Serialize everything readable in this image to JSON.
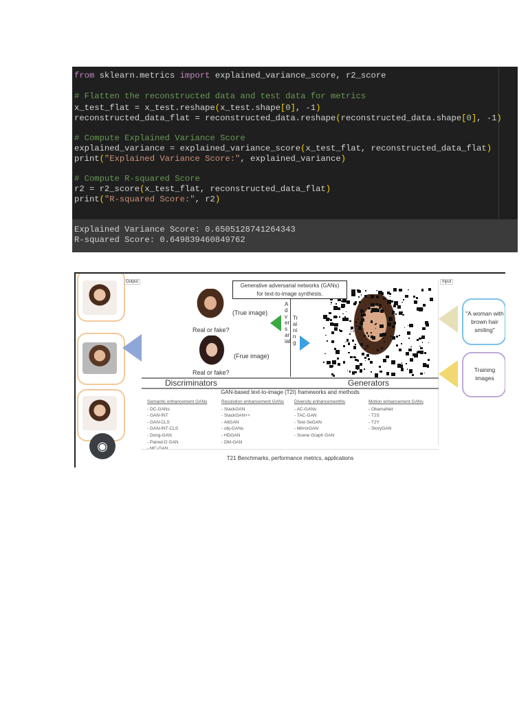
{
  "code": {
    "lines": [
      [
        [
          "from",
          "kw"
        ],
        [
          " sklearn.metrics ",
          ""
        ],
        [
          "import",
          "kw"
        ],
        [
          " explained_variance_score, r2_score",
          ""
        ]
      ],
      [],
      [
        [
          "# Flatten the reconstructed data and test data for metrics",
          "cm"
        ]
      ],
      [
        [
          "x_test_flat = x_test.reshape",
          ""
        ],
        [
          "(",
          "pn"
        ],
        [
          "x_test.shape",
          ""
        ],
        [
          "[",
          "pn"
        ],
        [
          "0",
          "nm"
        ],
        [
          "]",
          "pn"
        ],
        [
          ", -1",
          ""
        ],
        [
          ")",
          "pn"
        ]
      ],
      [
        [
          "reconstructed_data_flat = reconstructed_data.reshape",
          ""
        ],
        [
          "(",
          "pn"
        ],
        [
          "reconstructed_data.shape",
          ""
        ],
        [
          "[",
          "pn"
        ],
        [
          "0",
          "nm"
        ],
        [
          "]",
          "pn"
        ],
        [
          ", -1",
          ""
        ],
        [
          ")",
          "pn"
        ]
      ],
      [],
      [
        [
          "# Compute Explained Variance Score",
          "cm"
        ]
      ],
      [
        [
          "explained_variance = explained_variance_score",
          ""
        ],
        [
          "(",
          "pn"
        ],
        [
          "x_test_flat, reconstructed_data_flat",
          ""
        ],
        [
          ")",
          "pn"
        ]
      ],
      [
        [
          "print",
          ""
        ],
        [
          "(",
          "pn"
        ],
        [
          "\"Explained Variance Score:\"",
          "st"
        ],
        [
          ", explained_variance",
          ""
        ],
        [
          ")",
          "pn"
        ]
      ],
      [],
      [
        [
          "# Compute R-squared Score",
          "cm"
        ]
      ],
      [
        [
          "r2 = r2_score",
          ""
        ],
        [
          "(",
          "pn"
        ],
        [
          "x_test_flat, reconstructed_data_flat",
          ""
        ],
        [
          ")",
          "pn"
        ]
      ],
      [
        [
          "print",
          ""
        ],
        [
          "(",
          "pn"
        ],
        [
          "\"R-squared Score:\"",
          "st"
        ],
        [
          ", r2",
          ""
        ],
        [
          ")",
          "pn"
        ]
      ]
    ],
    "output": [
      "Explained Variance Score: 0.6505128741264343",
      "R-squared Score: 0.649839460849762"
    ]
  },
  "diagram": {
    "output_label": "Output",
    "input_label": "Input",
    "title_line1": "Generative adversarial networks (GANs)",
    "title_line2": "for text-to-image synthesis.",
    "true_image": "(True image)",
    "frue_image": "(Frue image)",
    "real_or_fake": "Real or fake?",
    "adversarial": "Adversarial",
    "training": "Training",
    "prompt": "\"A woman with brown hair smiling\"",
    "training_images": "Training images",
    "discriminators": "Discriminators",
    "generators": "Generators",
    "frameworks_title": "GAN-based text-to-image (T2I) frameworks and methods",
    "columns": [
      {
        "heading": "Semantic enhancement GANs",
        "items": [
          "- DC-GANs",
          "- GAN-INT",
          "- GAN-CLS",
          "- GAN-INT-CLS",
          "- Dong-GAN",
          "- Paired-D GAN",
          "- MC-GAN"
        ]
      },
      {
        "heading": "Resolution enhancement GANs",
        "items": [
          "- StackGAN",
          "- StackGAN++",
          "- AttGAN",
          "- obj-GANs",
          "- HDGAN",
          "- DM-GAN"
        ]
      },
      {
        "heading": "Diversity enhancementNs",
        "items": [
          "- AC-GANs",
          "- TAC-GAN",
          "- Text-SeGAN",
          "- MirrorGAN",
          "- Scene Graph GAN"
        ]
      },
      {
        "heading": "Motion enhancement GANs",
        "items": [
          "- ObamaNet",
          "- T2S",
          "- T2Y",
          "- StoryGAN"
        ]
      }
    ],
    "benchmarks": "T21 Benchmarks, performance metrics, applications",
    "colors": {
      "green_arrow": "#3aa845",
      "blue_arrow": "#3aa0e0"
    }
  },
  "icons": {
    "lens": "visual-search-icon"
  }
}
